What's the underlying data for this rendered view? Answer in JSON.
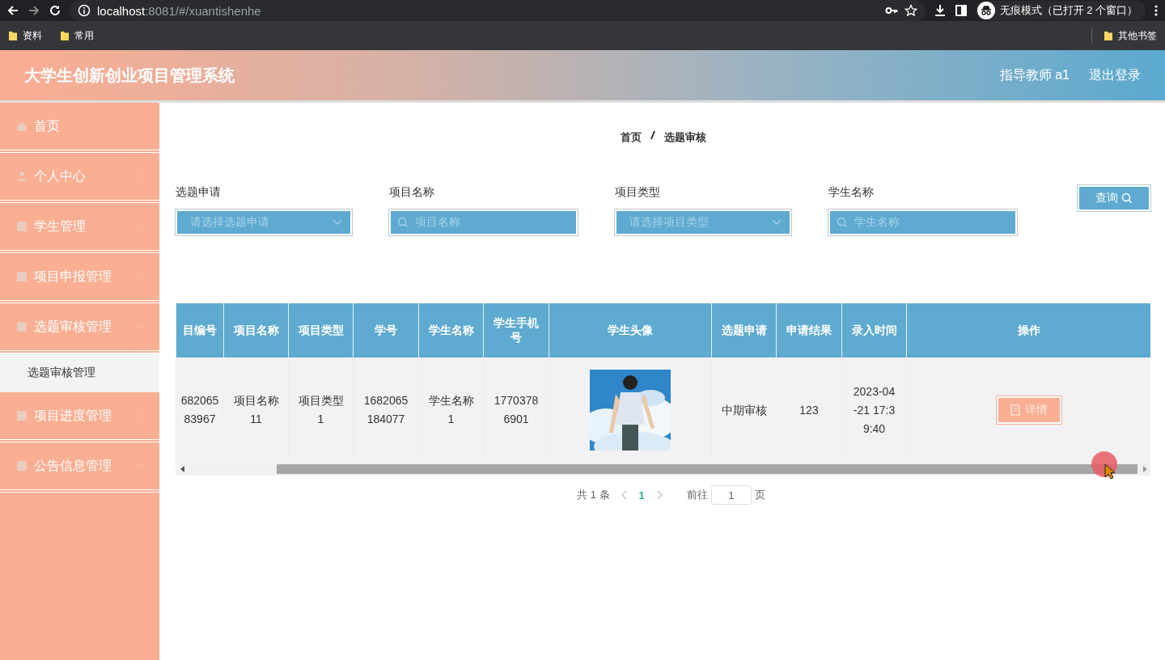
{
  "browser": {
    "address_host": "localhost",
    "address_path": ":8081/#/xuantishenhe",
    "incognito": "无痕模式（已打开 2 个窗口）",
    "bookmarks": [
      "资料",
      "常用"
    ],
    "other_bookmarks": "其他书签"
  },
  "header": {
    "title": "大学生创新创业项目管理系统",
    "user": "指导教师 a1",
    "logout": "退出登录"
  },
  "sidebar": {
    "items": [
      {
        "label": "首页",
        "kind": "link"
      },
      {
        "label": "个人中心",
        "kind": "menu",
        "expanded": false
      },
      {
        "label": "学生管理",
        "kind": "menu",
        "expanded": false
      },
      {
        "label": "项目申报管理",
        "kind": "menu",
        "expanded": false
      },
      {
        "label": "选题审核管理",
        "kind": "menu",
        "expanded": true,
        "children": [
          {
            "label": "选题审核管理",
            "selected": true
          }
        ]
      },
      {
        "label": "项目进度管理",
        "kind": "menu",
        "expanded": false
      },
      {
        "label": "公告信息管理",
        "kind": "menu",
        "expanded": false
      }
    ]
  },
  "breadcrumb": [
    "首页",
    "选题审核"
  ],
  "filters": [
    {
      "label": "选题申请",
      "kind": "select",
      "placeholder": "请选择选题申请"
    },
    {
      "label": "项目名称",
      "kind": "search",
      "placeholder": "项目名称"
    },
    {
      "label": "项目类型",
      "kind": "select",
      "placeholder": "请选择项目类型"
    },
    {
      "label": "学生名称",
      "kind": "search",
      "placeholder": "学生名称"
    }
  ],
  "search_button": "查询",
  "table": {
    "columns": [
      "目编号",
      "项目名称",
      "项目类型",
      "学号",
      "学生名称",
      "学生手机号",
      "学生头像",
      "选题申请",
      "申请结果",
      "录入时间",
      "操作"
    ],
    "rows": [
      {
        "cells": [
          {
            "kind": "text",
            "text": "682065 83967"
          },
          {
            "kind": "text",
            "text": "项目名称11"
          },
          {
            "kind": "text",
            "text": "项目类型1"
          },
          {
            "kind": "text",
            "text": "1682065184077"
          },
          {
            "kind": "text",
            "text": "学生名称1"
          },
          {
            "kind": "text",
            "text": "17703786901"
          },
          {
            "kind": "picture"
          },
          {
            "kind": "text",
            "text": "中期审核"
          },
          {
            "kind": "text",
            "text": "123"
          },
          {
            "kind": "text",
            "text": "2023-04-21 17:39:40"
          },
          {
            "kind": "button",
            "text": "详情"
          }
        ]
      }
    ]
  },
  "pagination": {
    "total": "共 1 条",
    "pages": [
      {
        "label": "1",
        "selected": true
      }
    ],
    "goto": "前往",
    "page_value": "1",
    "page_unit": "页"
  }
}
